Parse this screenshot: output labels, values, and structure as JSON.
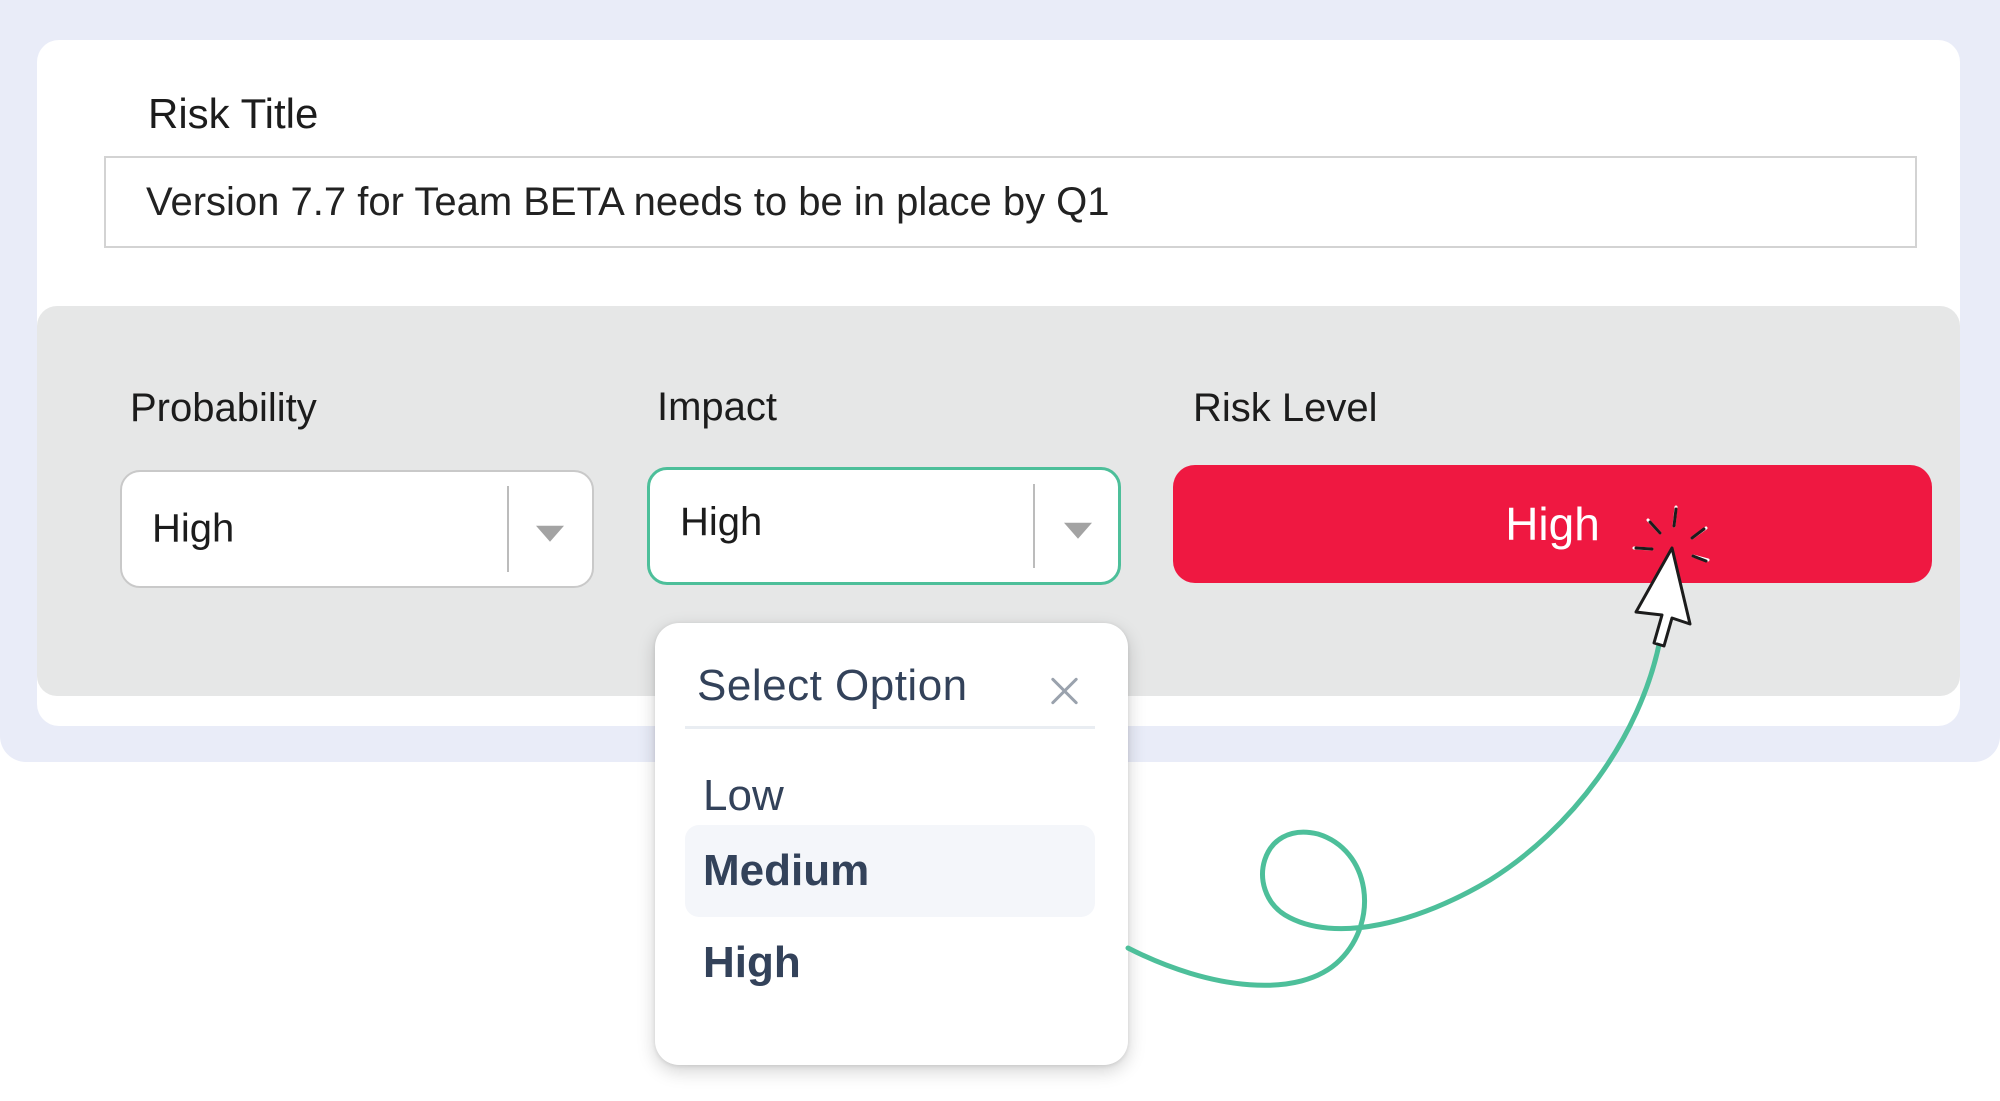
{
  "form": {
    "risk_title_label": "Risk Title",
    "risk_title_value": "Version 7.7 for Team BETA needs to be in place by Q1"
  },
  "probability": {
    "label": "Probability",
    "selected": "High"
  },
  "impact": {
    "label": "Impact",
    "selected": "High"
  },
  "risk_level": {
    "label": "Risk Level",
    "value": "High",
    "color": "#ef1841"
  },
  "dropdown": {
    "header": "Select Option",
    "options": [
      "Low",
      "Medium",
      "High"
    ],
    "hovered_option": "Medium"
  },
  "colors": {
    "frame": "#e9ecf8",
    "band": "#e6e7e7",
    "focus_border": "#4dbf9a",
    "curve": "#4dbf9a",
    "risk_high": "#ef1841"
  },
  "icons": {
    "dropdown_arrow": "caret-down-icon",
    "close": "close-icon",
    "cursor": "mouse-pointer-icon"
  }
}
